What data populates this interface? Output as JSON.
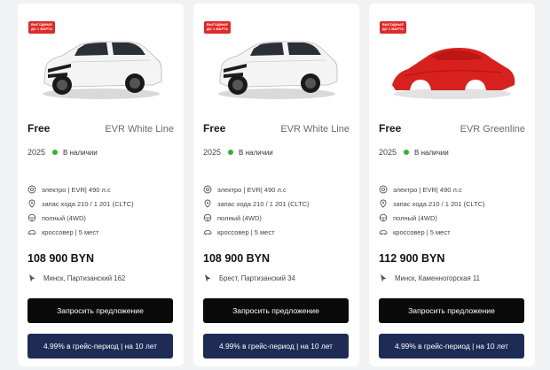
{
  "cards": [
    {
      "badge": [
        "ВЫГОДНЫЕ",
        "ДО 1 МАРТА"
      ],
      "image": "white-suv",
      "brand": "Free",
      "model": "EVR White Line",
      "year": "2025",
      "availability": "В наличии",
      "specs": [
        {
          "icon": "engine-icon",
          "text": "электро | EVR| 490 л.с"
        },
        {
          "icon": "range-icon",
          "text": "запас хода 210 / 1 201 (CLTC)"
        },
        {
          "icon": "drive-icon",
          "text": "полный (4WD)"
        },
        {
          "icon": "car-body-icon",
          "text": "кроссовер | 5 мест"
        }
      ],
      "price": "108 900 BYN",
      "location": "Минск, Партизанский 162",
      "request_label": "Запросить предложение",
      "grace_label": "4.99% в грейс-период | на 10 лет"
    },
    {
      "badge": [
        "ВЫГОДНЫЕ",
        "ДО 1 МАРТА"
      ],
      "image": "white-suv",
      "brand": "Free",
      "model": "EVR White Line",
      "year": "2025",
      "availability": "В наличии",
      "specs": [
        {
          "icon": "engine-icon",
          "text": "электро | EVR| 490 л.с"
        },
        {
          "icon": "range-icon",
          "text": "запас хода 210 / 1 201 (CLTC)"
        },
        {
          "icon": "drive-icon",
          "text": "полный (4WD)"
        },
        {
          "icon": "car-body-icon",
          "text": "кроссовер | 5 мест"
        }
      ],
      "price": "108 900 BYN",
      "location": "Брест, Партизанский 34",
      "request_label": "Запросить предложение",
      "grace_label": "4.99% в грейс-период | на 10 лет"
    },
    {
      "badge": [
        "ВЫГОДНЫЕ",
        "ДО 1 МАРТА"
      ],
      "image": "covered-car",
      "brand": "Free",
      "model": "EVR Greenline",
      "year": "2025",
      "availability": "В наличии",
      "specs": [
        {
          "icon": "engine-icon",
          "text": "электро | EVR| 490 л.с"
        },
        {
          "icon": "range-icon",
          "text": "запас хода 210 / 1 201 (CLTC)"
        },
        {
          "icon": "drive-icon",
          "text": "полный (4WD)"
        },
        {
          "icon": "car-body-icon",
          "text": "кроссовер | 5 мест"
        }
      ],
      "price": "112 900 BYN",
      "location": "Минск, Каменногорская 11",
      "request_label": "Запросить предложение",
      "grace_label": "4.99% в грейс-период | на 10 лет"
    }
  ],
  "colors": {
    "badge": "#e02a2a",
    "available_dot": "#34b233",
    "request_button": "#0a0a0a",
    "grace_button": "#1e2b55",
    "covered_car": "#d8201f"
  }
}
